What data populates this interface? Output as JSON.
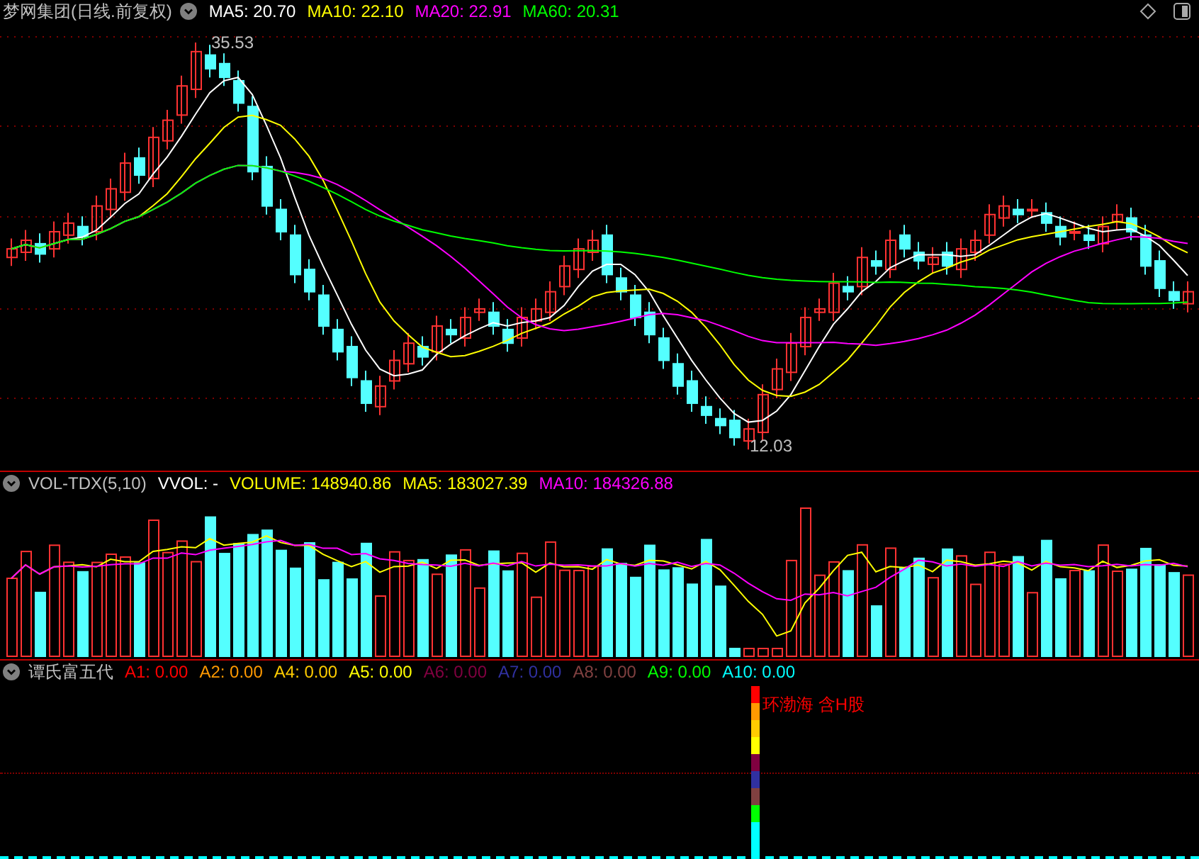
{
  "chart_header": {
    "title": "梦网集团(日线.前复权)",
    "indicators": [
      {
        "label": "MA5: 20.70",
        "color": "#ffffff"
      },
      {
        "label": "MA10: 22.10",
        "color": "#ffff00"
      },
      {
        "label": "MA20: 22.91",
        "color": "#ff00ff"
      },
      {
        "label": "MA60: 20.31",
        "color": "#00ff00"
      }
    ]
  },
  "price_chart": {
    "high_label": "35.53",
    "low_label": "12.03"
  },
  "volume_header": {
    "title": "VOL-TDX(5,10)",
    "indicators": [
      {
        "label": "VVOL: -",
        "color": "#ffffff"
      },
      {
        "label": "VOLUME: 148940.86",
        "color": "#ffff00"
      },
      {
        "label": "MA5: 183027.39",
        "color": "#ffff00"
      },
      {
        "label": "MA10: 184326.88",
        "color": "#ff00ff"
      }
    ]
  },
  "indicator_header": {
    "title": "谭氏富五代",
    "indicators": [
      {
        "label": "A1: 0.00",
        "color": "#ff0000"
      },
      {
        "label": "A2: 0.00",
        "color": "#ff9900"
      },
      {
        "label": "A4: 0.00",
        "color": "#ffcc00"
      },
      {
        "label": "A5: 0.00",
        "color": "#ffff00"
      },
      {
        "label": "A6: 0.00",
        "color": "#800040"
      },
      {
        "label": "A7: 0.00",
        "color": "#3030a0"
      },
      {
        "label": "A8: 0.00",
        "color": "#804040"
      },
      {
        "label": "A9: 0.00",
        "color": "#00ff00"
      },
      {
        "label": "A10: 0.00",
        "color": "#00ffff"
      }
    ]
  },
  "indicator_panel": {
    "tag": "环渤海 含H股"
  }
}
